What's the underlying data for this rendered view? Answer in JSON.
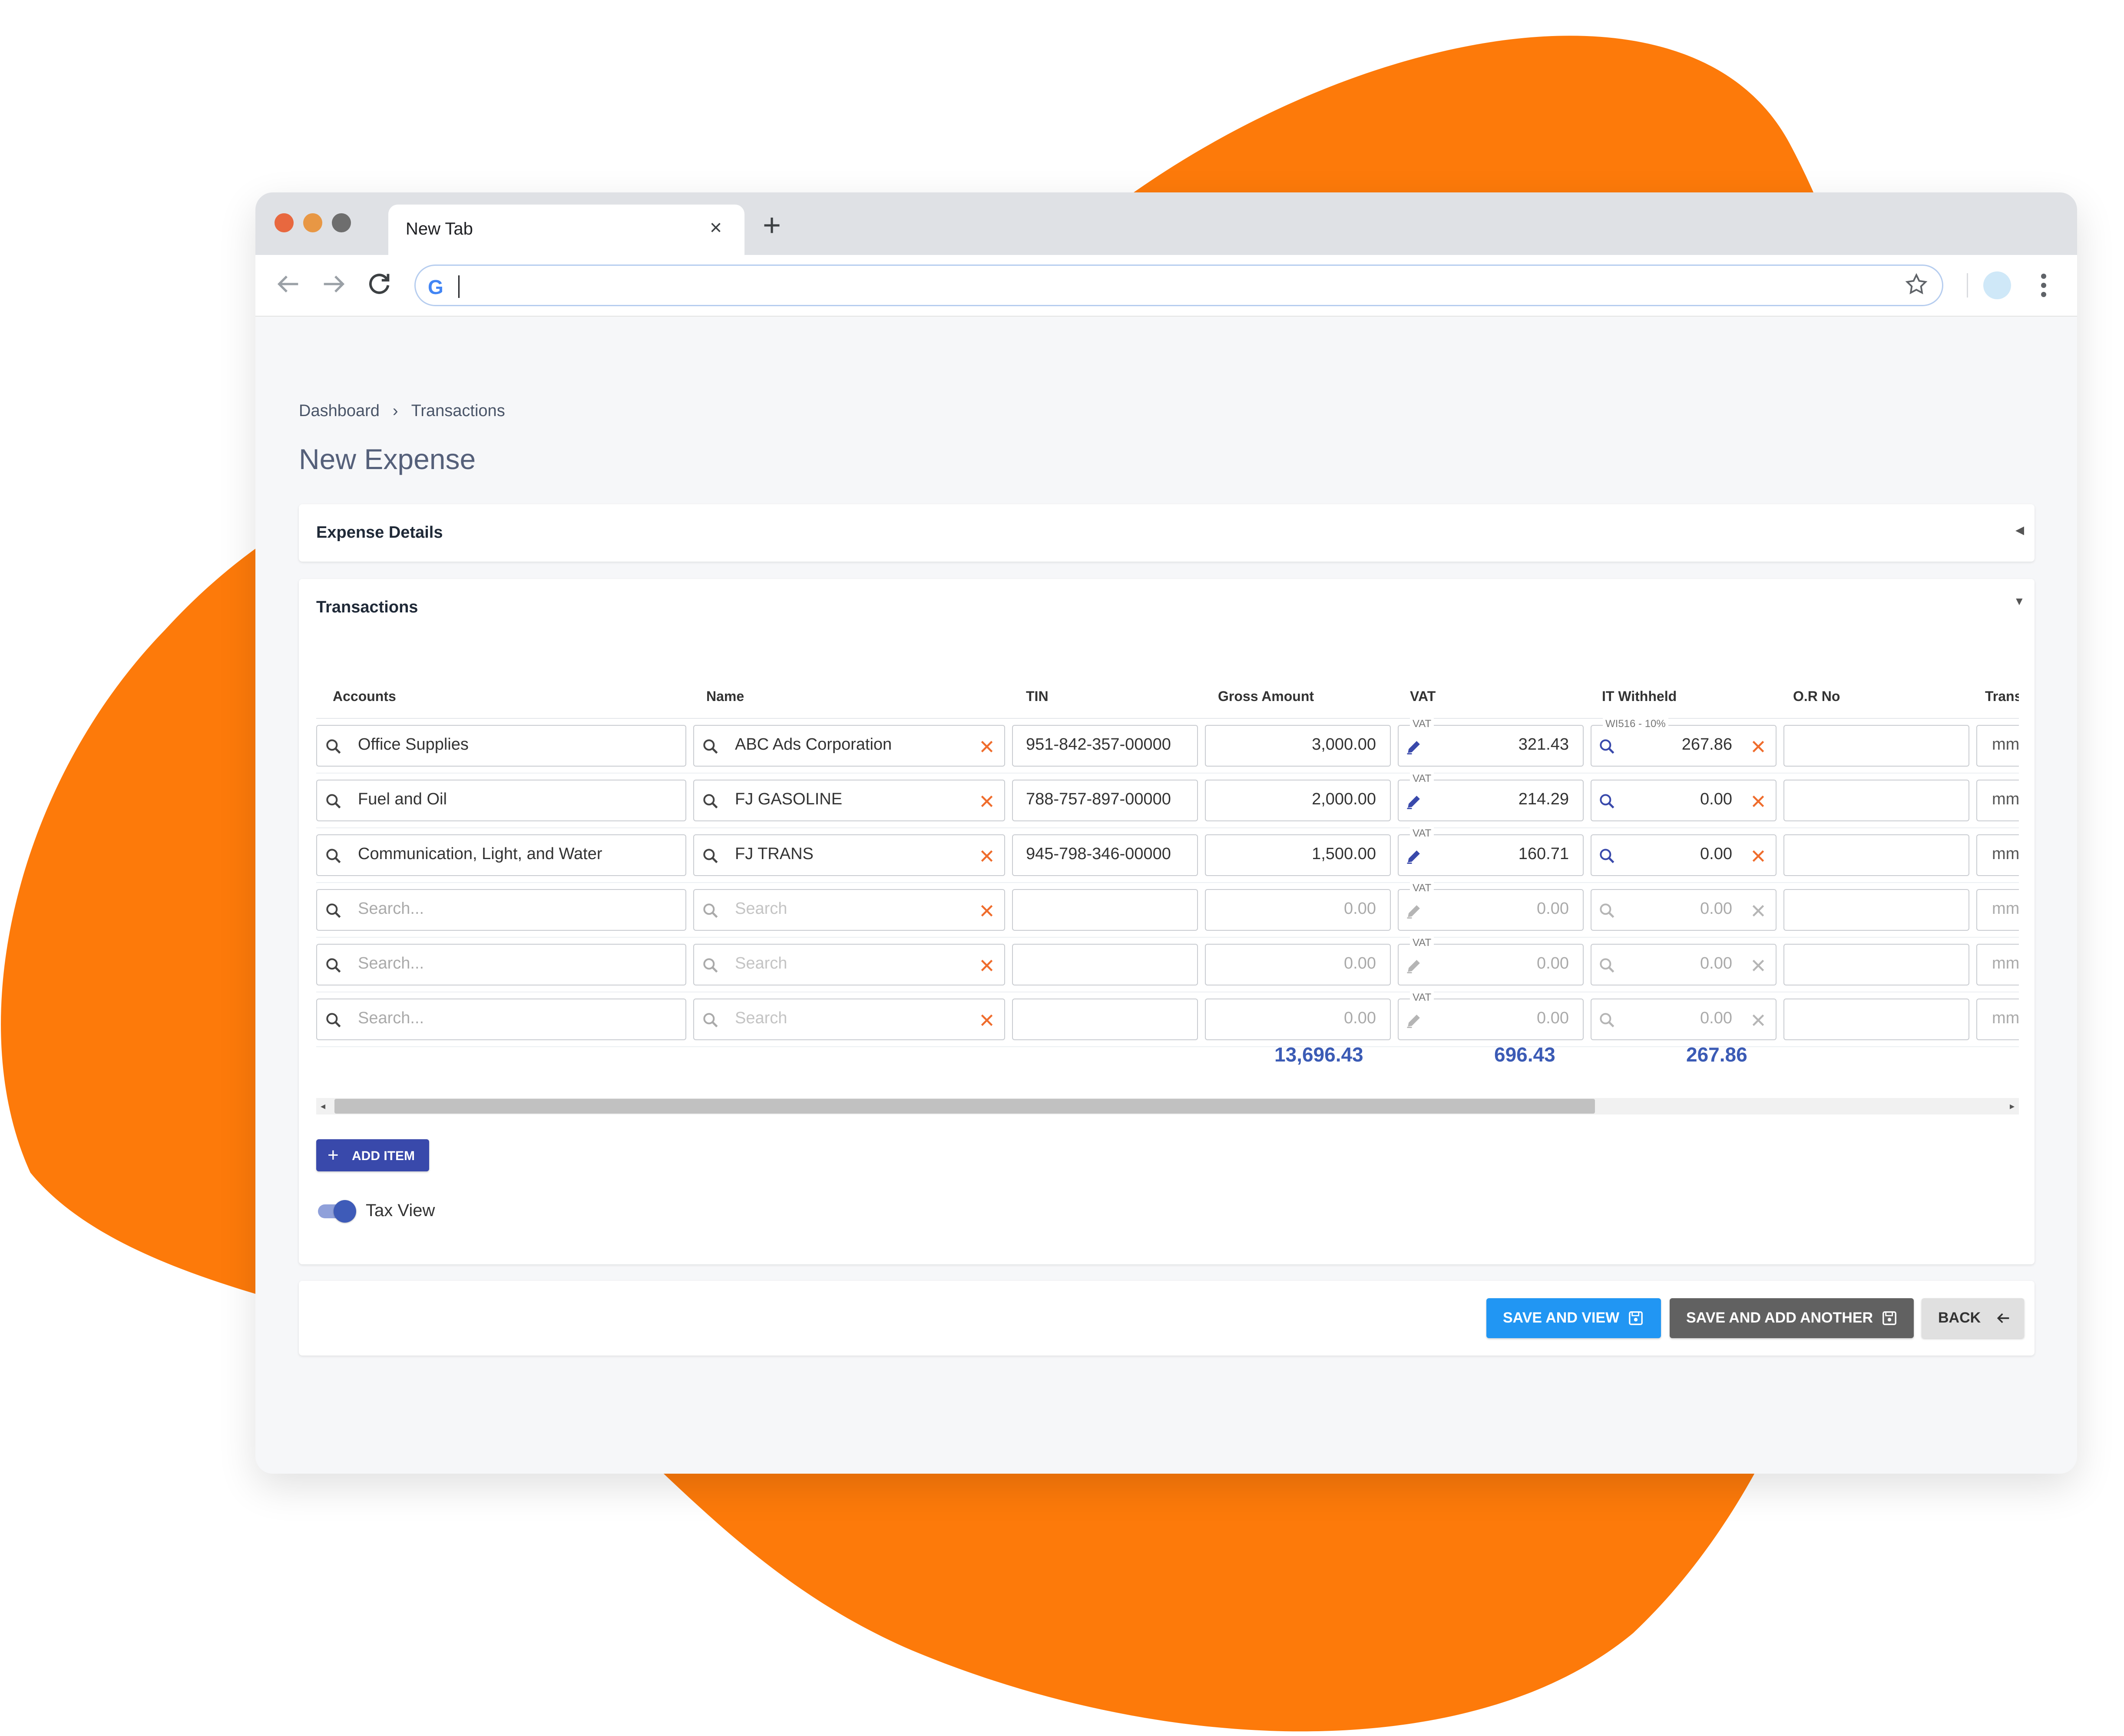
{
  "browser": {
    "tab_title": "New Tab",
    "tab_close": "×",
    "new_tab": "+",
    "url": ""
  },
  "breadcrumb": {
    "home": "Dashboard",
    "separator": "›",
    "current": "Transactions"
  },
  "page_title": "New Expense",
  "sections": {
    "expense_details": "Expense Details",
    "transactions": "Transactions"
  },
  "table": {
    "columns": [
      "Accounts",
      "Name",
      "TIN",
      "Gross Amount",
      "VAT",
      "IT Withheld",
      "O.R No",
      "Trans"
    ],
    "vat_label": "VAT",
    "rows": [
      {
        "account": "Office Supplies",
        "name": "ABC Ads Corporation",
        "tin": "951-842-357-00000",
        "gross": "3,000.00",
        "vat": "321.43",
        "it_label": "WI516 - 10%",
        "it": "267.86",
        "or": "",
        "trans": "mm/"
      },
      {
        "account": "Fuel and Oil",
        "name": "FJ GASOLINE",
        "tin": "788-757-897-00000",
        "gross": "2,000.00",
        "vat": "214.29",
        "it_label": "",
        "it": "0.00",
        "or": "",
        "trans": "mm/"
      },
      {
        "account": "Communication, Light, and Water",
        "name": "FJ TRANS",
        "tin": "945-798-346-00000",
        "gross": "1,500.00",
        "vat": "160.71",
        "it_label": "",
        "it": "0.00",
        "or": "",
        "trans": "mm/"
      },
      {
        "account": "Search...",
        "name": "Search",
        "tin": "",
        "gross": "0.00",
        "vat": "0.00",
        "it_label": "",
        "it": "0.00",
        "or": "",
        "trans": "mm/"
      },
      {
        "account": "Search...",
        "name": "Search",
        "tin": "",
        "gross": "0.00",
        "vat": "0.00",
        "it_label": "",
        "it": "0.00",
        "or": "",
        "trans": "mm/"
      },
      {
        "account": "Search...",
        "name": "Search",
        "tin": "",
        "gross": "0.00",
        "vat": "0.00",
        "it_label": "",
        "it": "0.00",
        "or": "",
        "trans": "mm/"
      }
    ],
    "totals": {
      "gross": "13,696.43",
      "vat": "696.43",
      "it": "267.86"
    }
  },
  "add_item": {
    "icon": "+",
    "label": "ADD ITEM"
  },
  "tax_view": {
    "label": "Tax View",
    "on": true
  },
  "actions": {
    "save_view": "SAVE AND VIEW",
    "save_add": "SAVE AND ADD ANOTHER",
    "back": "BACK"
  },
  "colors": {
    "accent_orange": "#fd7a0a",
    "primary_indigo": "#3949ab",
    "save_blue": "#2196f3",
    "save_grey": "#616161",
    "totals_blue": "#3b5bb5"
  }
}
